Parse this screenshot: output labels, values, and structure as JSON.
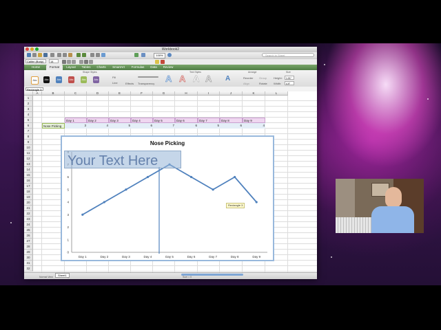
{
  "window": {
    "title": "Workbook2",
    "zoom": "100%",
    "search_placeholder": "Search in Sheet",
    "font_name": "Calibri (Body)",
    "font_size": "14"
  },
  "ribbon": {
    "tabs": [
      "Home",
      "Format",
      "Layout",
      "Tables",
      "Charts",
      "SmartArt",
      "Formulas",
      "Data",
      "Review"
    ],
    "active_tab": "Format",
    "groups": [
      "Shape Styles",
      "Text Styles",
      "Arrange",
      "Size"
    ],
    "style_swatches": [
      "Abc",
      "Abc",
      "Abc",
      "Abc",
      "Abc",
      "Abc"
    ],
    "swatch_colors": [
      "#ffffff",
      "#111111",
      "#4f81bd",
      "#c0504d",
      "#9bbb59",
      "#8064a2"
    ],
    "fill_label": "Fill",
    "line_label": "Line",
    "effects_label": "Effects",
    "transparency_label": "Transparency",
    "reorder_label": "Reorder",
    "group_label": "Group",
    "rotate_label": "Rotate",
    "align_label": "Align",
    "height_label": "Height:",
    "width_label": "Width:",
    "height_value": "1.01\"",
    "width_value": "4.9\""
  },
  "formula_bar": {
    "name_box": "Rectangle 3"
  },
  "sheet": {
    "columns": [
      "A",
      "B",
      "C",
      "D",
      "E",
      "F",
      "G",
      "H",
      "I",
      "J",
      "K",
      "L"
    ],
    "rows": [
      "1",
      "2",
      "3",
      "4",
      "5",
      "6",
      "7",
      "8",
      "9",
      "10",
      "11",
      "12",
      "13",
      "14",
      "15",
      "16",
      "17",
      "18",
      "19",
      "20",
      "21",
      "22",
      "23",
      "24",
      "25",
      "26",
      "27",
      "28",
      "29",
      "30",
      "31",
      "32"
    ],
    "row_label": "Nose Picking",
    "day_headers": [
      "Day 1",
      "Day 2",
      "Day 3",
      "Day 4",
      "Day 5",
      "Day 6",
      "Day 7",
      "Day 8",
      "Day 9"
    ],
    "values": [
      "3",
      "4",
      "5",
      "6",
      "7",
      "6",
      "5",
      "6",
      "4"
    ]
  },
  "chart_data": {
    "type": "line",
    "title": "Nose Picking",
    "categories": [
      "Day 1",
      "Day 2",
      "Day 3",
      "Day 4",
      "Day 5",
      "Day 6",
      "Day 7",
      "Day 8",
      "Day 9"
    ],
    "values": [
      3,
      4,
      5,
      6,
      7,
      6,
      5,
      6,
      4
    ],
    "ylim": [
      0,
      8
    ],
    "yticks": [
      "0",
      "1",
      "2",
      "3",
      "4",
      "5",
      "6",
      "7",
      "8"
    ],
    "line_color": "#4f81bd",
    "grid": false
  },
  "overlay": {
    "textbox_text": "Your Text Here",
    "tooltip": "Rectangle 3"
  },
  "status": {
    "view_labels": [
      "Normal View",
      "Ready"
    ],
    "sheet_tab": "Sheet1",
    "sum_text": "Sum = 0"
  }
}
